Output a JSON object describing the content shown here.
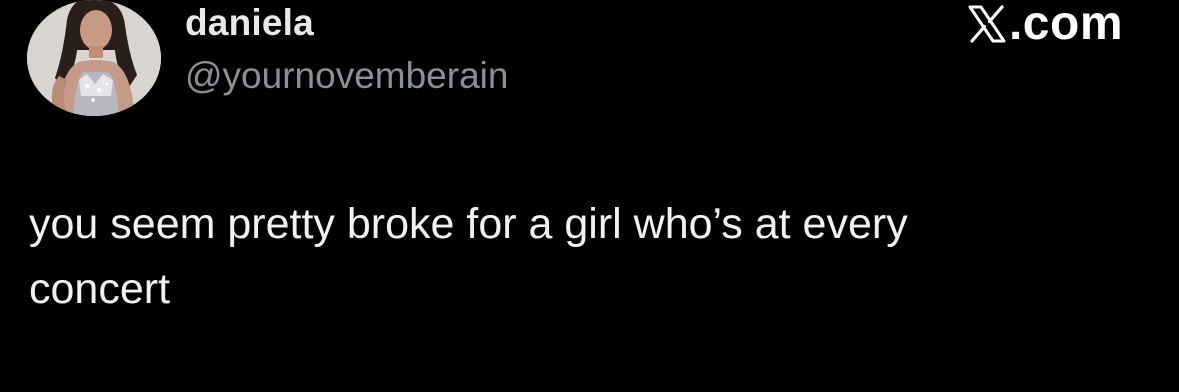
{
  "tweet": {
    "author": {
      "display_name": "daniela",
      "handle": "@yournovemberain",
      "avatar_icon": "profile-photo"
    },
    "brand": {
      "logo_icon": "x-logo-icon",
      "text": ".com"
    },
    "text_lines": [
      "you seem pretty broke for a girl who’s at every",
      "concert"
    ]
  },
  "colors": {
    "background": "#000000",
    "primary_text": "#e7e9ea",
    "secondary_text": "#8b9096",
    "brand": "#ffffff"
  }
}
